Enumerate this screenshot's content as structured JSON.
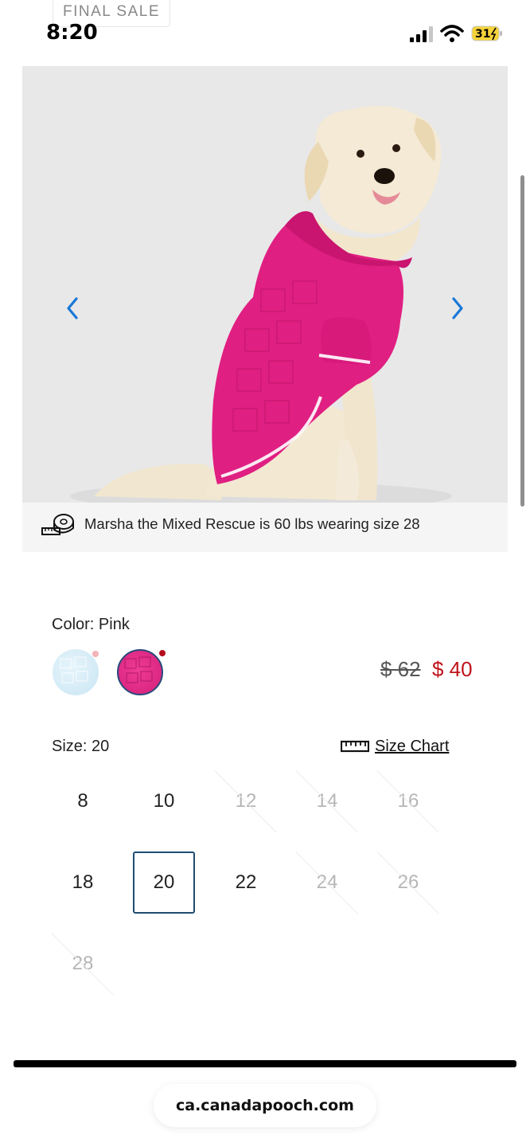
{
  "status_bar": {
    "final_sale": "FINAL SALE",
    "time": "8:20",
    "battery": "31"
  },
  "gallery": {
    "caption": "Marsha the Mixed Rescue is 60 lbs wearing size 28",
    "product_color": "#e01f82",
    "icons": {
      "prev": "chevron-left-icon",
      "next": "chevron-right-icon",
      "caption": "measuring-tape-icon"
    }
  },
  "color": {
    "label": "Color: Pink",
    "options": [
      {
        "name": "Light Blue",
        "hex": "#d6edf7"
      },
      {
        "name": "Pink",
        "hex": "#e22a88",
        "selected": true
      }
    ]
  },
  "price": {
    "original": "$ 62",
    "sale": "$ 40",
    "sale_color": "#c0141c"
  },
  "size": {
    "label": "Size: 20",
    "chart_link": "Size Chart",
    "chart_icon": "ruler-icon",
    "options": [
      {
        "value": "8",
        "available": true
      },
      {
        "value": "10",
        "available": true
      },
      {
        "value": "12",
        "available": false
      },
      {
        "value": "14",
        "available": false
      },
      {
        "value": "16",
        "available": false
      },
      {
        "value": "18",
        "available": true
      },
      {
        "value": "20",
        "available": true,
        "selected": true
      },
      {
        "value": "22",
        "available": true
      },
      {
        "value": "24",
        "available": false
      },
      {
        "value": "26",
        "available": false
      },
      {
        "value": "28",
        "available": false
      }
    ]
  },
  "browser": {
    "url": "ca.canadapooch.com"
  }
}
